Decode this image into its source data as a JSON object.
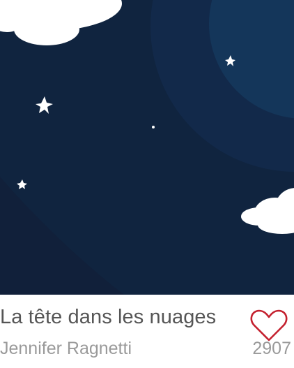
{
  "card": {
    "title": "La tête dans les nuages",
    "author": "Jennifer Ragnetti",
    "likes": "2907",
    "like_icon": "heart-outline-icon"
  },
  "colors": {
    "sky": "#10243f",
    "moon_halo": "#12294a",
    "moon": "#14365a",
    "hill": "#11203a",
    "heart": "#c4202e"
  }
}
